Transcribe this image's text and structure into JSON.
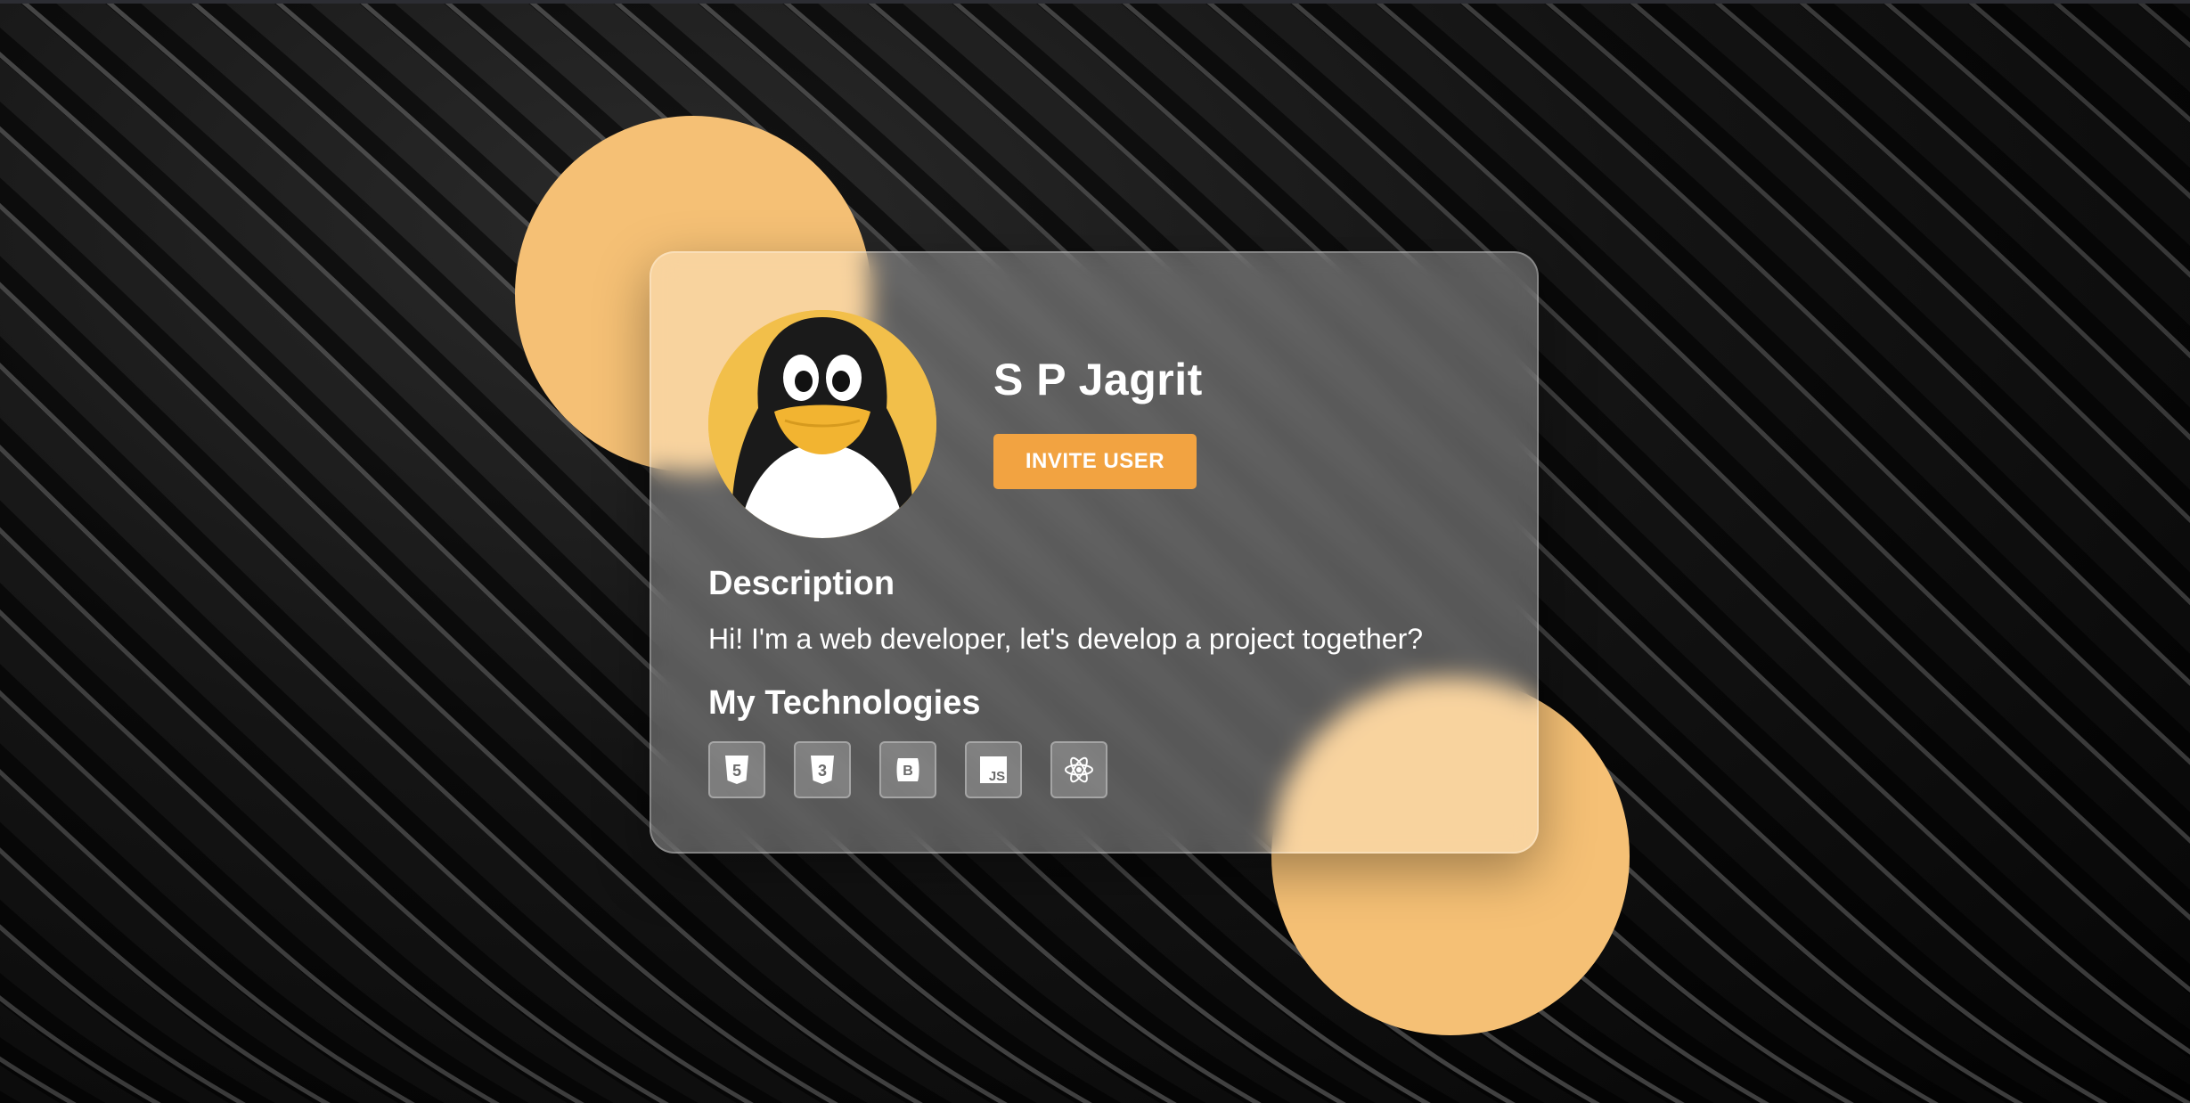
{
  "profile": {
    "name": "S P Jagrit",
    "invite_label": "INVITE USER",
    "avatar_icon": "penguin-avatar"
  },
  "description": {
    "title": "Description",
    "text": "Hi! I'm a web developer, let's develop a project together?"
  },
  "technologies": {
    "title": "My Technologies",
    "items": [
      {
        "icon": "html5-icon",
        "glyph": "5"
      },
      {
        "icon": "css3-icon",
        "glyph": "3"
      },
      {
        "icon": "bootstrap-icon",
        "glyph": "B"
      },
      {
        "icon": "javascript-icon",
        "glyph": "JS"
      },
      {
        "icon": "react-icon",
        "glyph": ""
      }
    ]
  },
  "colors": {
    "accent": "#f2a341",
    "circle": "#f5c075",
    "avatar_bg": "#f2bf4a"
  }
}
